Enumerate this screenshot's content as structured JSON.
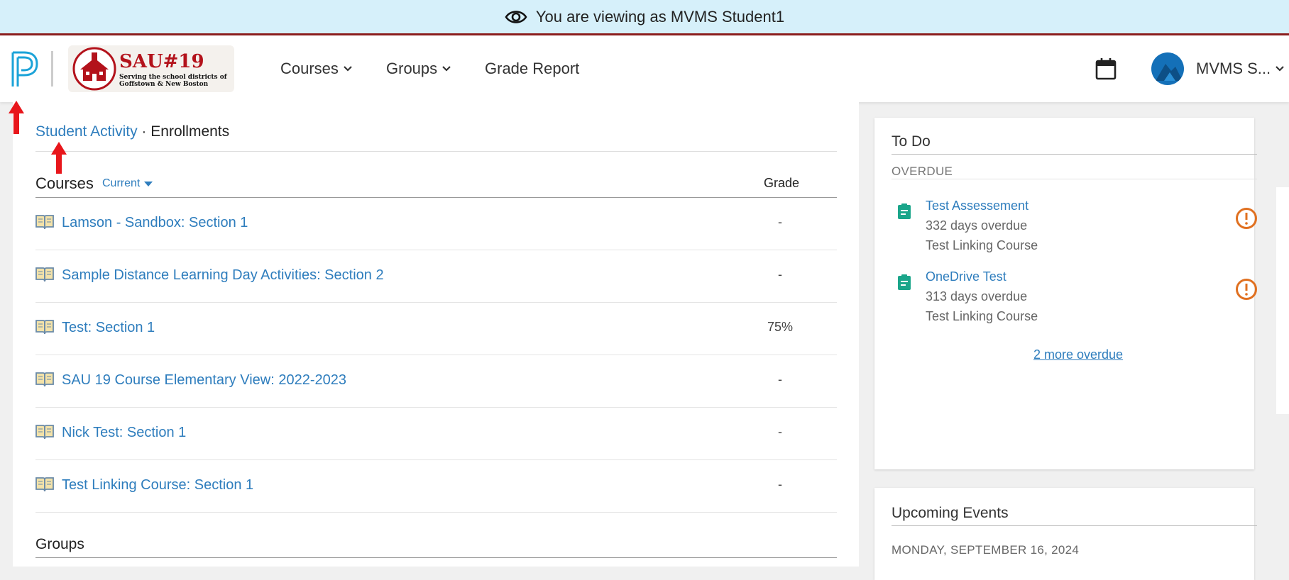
{
  "banner": {
    "text": "You are viewing as MVMS Student1"
  },
  "header": {
    "logo_title": "SAU#19",
    "logo_subtitle": "Serving the school districts of Goffstown & New Boston",
    "nav": [
      {
        "label": "Courses",
        "has_dropdown": true
      },
      {
        "label": "Groups",
        "has_dropdown": true
      },
      {
        "label": "Grade Report",
        "has_dropdown": false
      }
    ],
    "user_name": "MVMS S..."
  },
  "breadcrumb": {
    "link": "Student Activity",
    "separator": "·",
    "current": "Enrollments"
  },
  "courses": {
    "heading": "Courses",
    "filter": "Current",
    "grade_header": "Grade",
    "rows": [
      {
        "name": "Lamson - Sandbox: Section 1",
        "grade": "-"
      },
      {
        "name": "Sample Distance Learning Day Activities: Section 2",
        "grade": "-"
      },
      {
        "name": "Test: Section 1",
        "grade": "75%"
      },
      {
        "name": "SAU 19 Course Elementary View: 2022-2023",
        "grade": "-"
      },
      {
        "name": "Nick Test: Section 1",
        "grade": "-"
      },
      {
        "name": "Test Linking Course: Section 1",
        "grade": "-"
      }
    ]
  },
  "groups": {
    "heading": "Groups"
  },
  "todo": {
    "title": "To Do",
    "overdue_label": "OVERDUE",
    "items": [
      {
        "title": "Test Assessement",
        "due": "332 days overdue",
        "course": "Test Linking Course"
      },
      {
        "title": "OneDrive Test",
        "due": "313 days overdue",
        "course": "Test Linking Course"
      }
    ],
    "more_link": "2 more overdue"
  },
  "events": {
    "title": "Upcoming Events",
    "date_label": "MONDAY, SEPTEMBER 16, 2024"
  },
  "colors": {
    "link": "#2e7dbd",
    "banner_bg": "#d6f0fa",
    "banner_border": "#8b1c1c",
    "todo_icon": "#1aa58a",
    "alert": "#e07020",
    "annotation_arrow": "#e8161b"
  }
}
